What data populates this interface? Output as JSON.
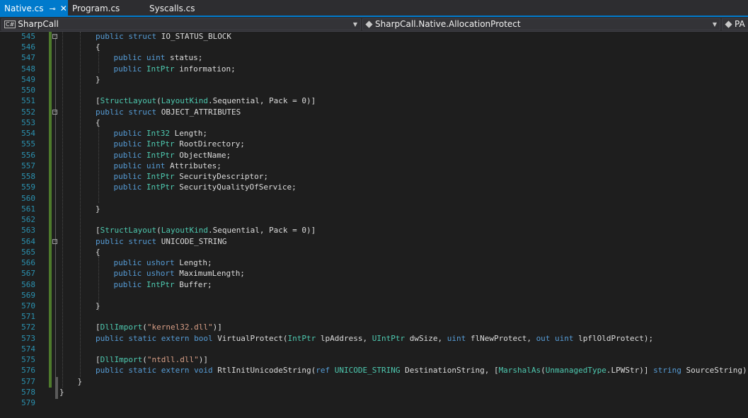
{
  "tabs": [
    {
      "label": "Native.cs",
      "pin": "⊸",
      "close": "✕"
    },
    {
      "label": "Program.cs"
    },
    {
      "label": "Syscalls.cs"
    }
  ],
  "nav": {
    "project": "SharpCall",
    "project_icon": "C#",
    "member": "SharpCall.Native.AllocationProtect",
    "third": "PA"
  },
  "colors": {
    "keyword": "#569cd6",
    "type": "#4ec9b0",
    "string": "#d69d85",
    "line_number": "#2b91af",
    "accent": "#007acc",
    "change_bar": "#4e7a2c"
  },
  "code_lines": [
    {
      "n": "545",
      "indent": 2,
      "tokens": [
        [
          "kw",
          "public struct "
        ],
        [
          "t",
          "IO_STATUS_BLOCK"
        ]
      ]
    },
    {
      "n": "546",
      "indent": 2,
      "tokens": [
        [
          "t",
          "{"
        ]
      ]
    },
    {
      "n": "547",
      "indent": 3,
      "tokens": [
        [
          "kw",
          "public uint "
        ],
        [
          "t",
          "status;"
        ]
      ]
    },
    {
      "n": "548",
      "indent": 3,
      "tokens": [
        [
          "kw",
          "public "
        ],
        [
          "ty",
          "IntPtr "
        ],
        [
          "t",
          "information;"
        ]
      ]
    },
    {
      "n": "549",
      "indent": 2,
      "tokens": [
        [
          "t",
          "}"
        ]
      ]
    },
    {
      "n": "550",
      "indent": 2,
      "tokens": []
    },
    {
      "n": "551",
      "indent": 2,
      "tokens": [
        [
          "t",
          "["
        ],
        [
          "ty",
          "StructLayout"
        ],
        [
          "t",
          "("
        ],
        [
          "ty",
          "LayoutKind"
        ],
        [
          "t",
          ".Sequential, Pack = 0)]"
        ]
      ]
    },
    {
      "n": "552",
      "indent": 2,
      "tokens": [
        [
          "kw",
          "public struct "
        ],
        [
          "t",
          "OBJECT_ATTRIBUTES"
        ]
      ]
    },
    {
      "n": "553",
      "indent": 2,
      "tokens": [
        [
          "t",
          "{"
        ]
      ]
    },
    {
      "n": "554",
      "indent": 3,
      "tokens": [
        [
          "kw",
          "public "
        ],
        [
          "ty",
          "Int32 "
        ],
        [
          "t",
          "Length;"
        ]
      ]
    },
    {
      "n": "555",
      "indent": 3,
      "tokens": [
        [
          "kw",
          "public "
        ],
        [
          "ty",
          "IntPtr "
        ],
        [
          "t",
          "RootDirectory;"
        ]
      ]
    },
    {
      "n": "556",
      "indent": 3,
      "tokens": [
        [
          "kw",
          "public "
        ],
        [
          "ty",
          "IntPtr "
        ],
        [
          "t",
          "ObjectName;"
        ]
      ]
    },
    {
      "n": "557",
      "indent": 3,
      "tokens": [
        [
          "kw",
          "public uint "
        ],
        [
          "t",
          "Attributes;"
        ]
      ]
    },
    {
      "n": "558",
      "indent": 3,
      "tokens": [
        [
          "kw",
          "public "
        ],
        [
          "ty",
          "IntPtr "
        ],
        [
          "t",
          "SecurityDescriptor;"
        ]
      ]
    },
    {
      "n": "559",
      "indent": 3,
      "tokens": [
        [
          "kw",
          "public "
        ],
        [
          "ty",
          "IntPtr "
        ],
        [
          "t",
          "SecurityQualityOfService;"
        ]
      ]
    },
    {
      "n": "560",
      "indent": 2,
      "tokens": []
    },
    {
      "n": "561",
      "indent": 2,
      "tokens": [
        [
          "t",
          "}"
        ]
      ]
    },
    {
      "n": "562",
      "indent": 2,
      "tokens": []
    },
    {
      "n": "563",
      "indent": 2,
      "tokens": [
        [
          "t",
          "["
        ],
        [
          "ty",
          "StructLayout"
        ],
        [
          "t",
          "("
        ],
        [
          "ty",
          "LayoutKind"
        ],
        [
          "t",
          ".Sequential, Pack = 0)]"
        ]
      ]
    },
    {
      "n": "564",
      "indent": 2,
      "tokens": [
        [
          "kw",
          "public struct "
        ],
        [
          "t",
          "UNICODE_STRING"
        ]
      ]
    },
    {
      "n": "565",
      "indent": 2,
      "tokens": [
        [
          "t",
          "{"
        ]
      ]
    },
    {
      "n": "566",
      "indent": 3,
      "tokens": [
        [
          "kw",
          "public ushort "
        ],
        [
          "t",
          "Length;"
        ]
      ]
    },
    {
      "n": "567",
      "indent": 3,
      "tokens": [
        [
          "kw",
          "public ushort "
        ],
        [
          "t",
          "MaximumLength;"
        ]
      ]
    },
    {
      "n": "568",
      "indent": 3,
      "tokens": [
        [
          "kw",
          "public "
        ],
        [
          "ty",
          "IntPtr "
        ],
        [
          "t",
          "Buffer;"
        ]
      ]
    },
    {
      "n": "569",
      "indent": 2,
      "tokens": []
    },
    {
      "n": "570",
      "indent": 2,
      "tokens": [
        [
          "t",
          "}"
        ]
      ]
    },
    {
      "n": "571",
      "indent": 2,
      "tokens": []
    },
    {
      "n": "572",
      "indent": 2,
      "tokens": [
        [
          "t",
          "["
        ],
        [
          "ty",
          "DllImport"
        ],
        [
          "t",
          "("
        ],
        [
          "str",
          "\"kernel32.dll\""
        ],
        [
          "t",
          ")]"
        ]
      ]
    },
    {
      "n": "573",
      "indent": 2,
      "tokens": [
        [
          "kw",
          "public static extern bool "
        ],
        [
          "t",
          "VirtualProtect("
        ],
        [
          "ty",
          "IntPtr "
        ],
        [
          "t",
          "lpAddress, "
        ],
        [
          "ty",
          "UIntPtr "
        ],
        [
          "t",
          "dwSize, "
        ],
        [
          "kw",
          "uint "
        ],
        [
          "t",
          "flNewProtect, "
        ],
        [
          "kw",
          "out uint "
        ],
        [
          "t",
          "lpflOldProtect);"
        ]
      ]
    },
    {
      "n": "574",
      "indent": 2,
      "tokens": []
    },
    {
      "n": "575",
      "indent": 2,
      "tokens": [
        [
          "t",
          "["
        ],
        [
          "ty",
          "DllImport"
        ],
        [
          "t",
          "("
        ],
        [
          "str",
          "\"ntdll.dll\""
        ],
        [
          "t",
          ")]"
        ]
      ]
    },
    {
      "n": "576",
      "indent": 2,
      "tokens": [
        [
          "kw",
          "public static extern void "
        ],
        [
          "t",
          "RtlInitUnicodeString("
        ],
        [
          "kw",
          "ref "
        ],
        [
          "ty",
          "UNICODE_STRING "
        ],
        [
          "t",
          "DestinationString, ["
        ],
        [
          "ty",
          "MarshalAs"
        ],
        [
          "t",
          "("
        ],
        [
          "ty",
          "UnmanagedType"
        ],
        [
          "t",
          ".LPWStr)] "
        ],
        [
          "kw",
          "string "
        ],
        [
          "t",
          "SourceString);"
        ]
      ]
    },
    {
      "n": "577",
      "indent": 1,
      "tokens": [
        [
          "t",
          "}"
        ]
      ]
    },
    {
      "n": "578",
      "indent": 0,
      "tokens": [
        [
          "t",
          "}"
        ]
      ]
    },
    {
      "n": "579",
      "indent": 0,
      "tokens": []
    }
  ]
}
